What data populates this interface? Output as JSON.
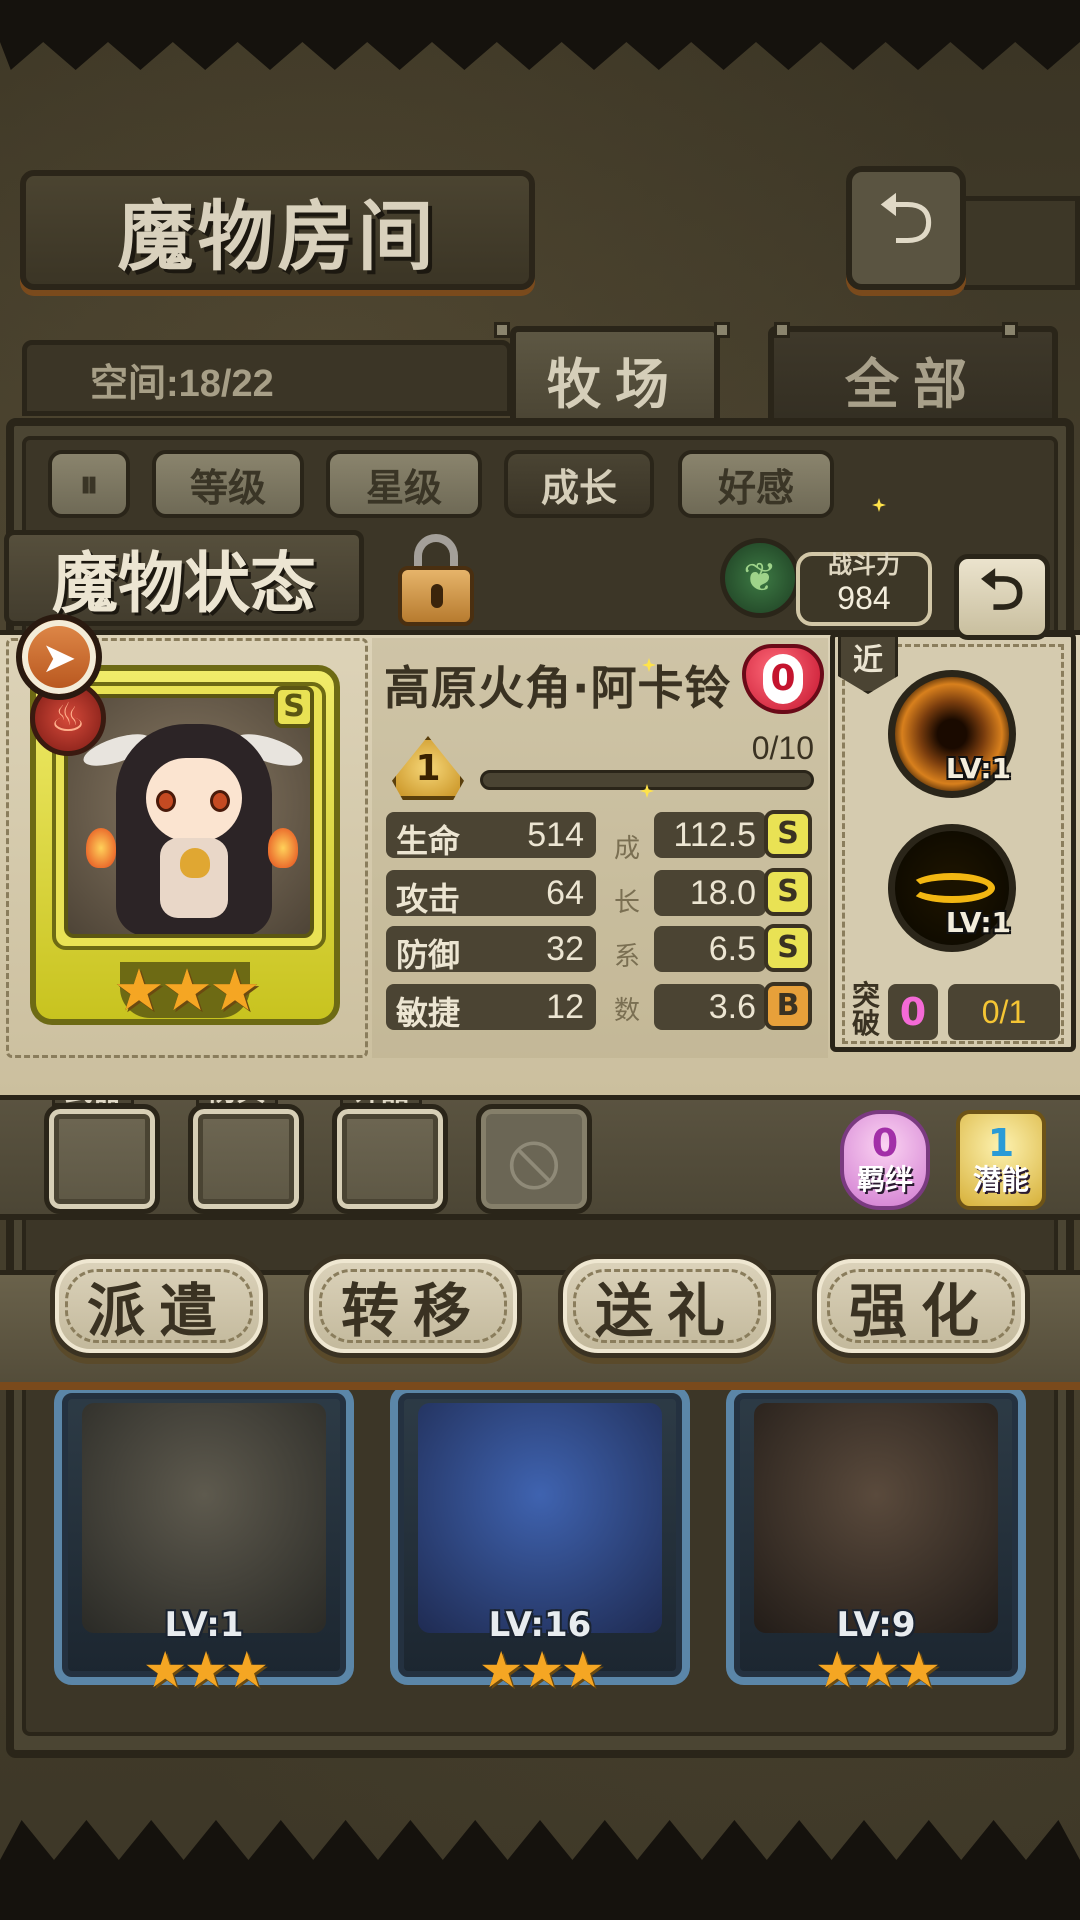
{
  "header": {
    "title": "魔物房间",
    "back_icon": "return-icon"
  },
  "storage": {
    "space_text": "空间:18/22"
  },
  "tabs": [
    {
      "label": "牧场",
      "active": true
    },
    {
      "label": "全部",
      "active": false
    }
  ],
  "sort": {
    "toggle_icon": "pause-icon",
    "buttons": [
      {
        "label": "等级"
      },
      {
        "label": "星级"
      },
      {
        "label": "成长",
        "active": true
      },
      {
        "label": "好感"
      }
    ]
  },
  "status": {
    "header": "魔物状态",
    "lock_icon": "padlock-icon",
    "power_label": "战斗力",
    "power_value": "984",
    "back_icon": "return-arrow-icon"
  },
  "monster": {
    "name": "高原火角·阿卡铃",
    "affection": "0",
    "grade": "S",
    "stars": 3,
    "level": "1",
    "exp_text": "0/10",
    "exp_fraction": 0.0,
    "stats": [
      {
        "name": "生命",
        "value": "514",
        "growth": "112.5",
        "grade": "S"
      },
      {
        "name": "攻击",
        "value": "64",
        "growth": "18.0",
        "grade": "S"
      },
      {
        "name": "防御",
        "value": "32",
        "growth": "6.5",
        "grade": "S"
      },
      {
        "name": "敏捷",
        "value": "12",
        "growth": "3.6",
        "grade": "B"
      }
    ],
    "growth_label_chars": [
      "成",
      "长",
      "系",
      "数"
    ],
    "range": "近",
    "skills": [
      {
        "lv": "LV:1",
        "icon": "dark-vortex-icon"
      },
      {
        "lv": "LV:1",
        "icon": "golden-swirl-icon"
      }
    ],
    "break_label": "突破",
    "break_count": "0",
    "break_progress": "0/1"
  },
  "equipment": {
    "slots": [
      {
        "label": "武器"
      },
      {
        "label": "防具"
      },
      {
        "label": "饰品"
      }
    ],
    "bond": {
      "value": "0",
      "label": "羁绊"
    },
    "potential": {
      "value": "1",
      "label": "潜能"
    }
  },
  "actions": [
    {
      "label": "派遣"
    },
    {
      "label": "转移"
    },
    {
      "label": "送礼"
    },
    {
      "label": "强化"
    }
  ],
  "roster": [
    {
      "lv": "LV:1",
      "stars": 3
    },
    {
      "lv": "LV:16",
      "stars": 3
    },
    {
      "lv": "LV:9",
      "stars": 3
    }
  ],
  "colors": {
    "accent_gold": "#e8c245",
    "panel_parchment": "#ddd3b8",
    "card_yellow": "#e9e254",
    "card_blue": "#5b86a8"
  }
}
